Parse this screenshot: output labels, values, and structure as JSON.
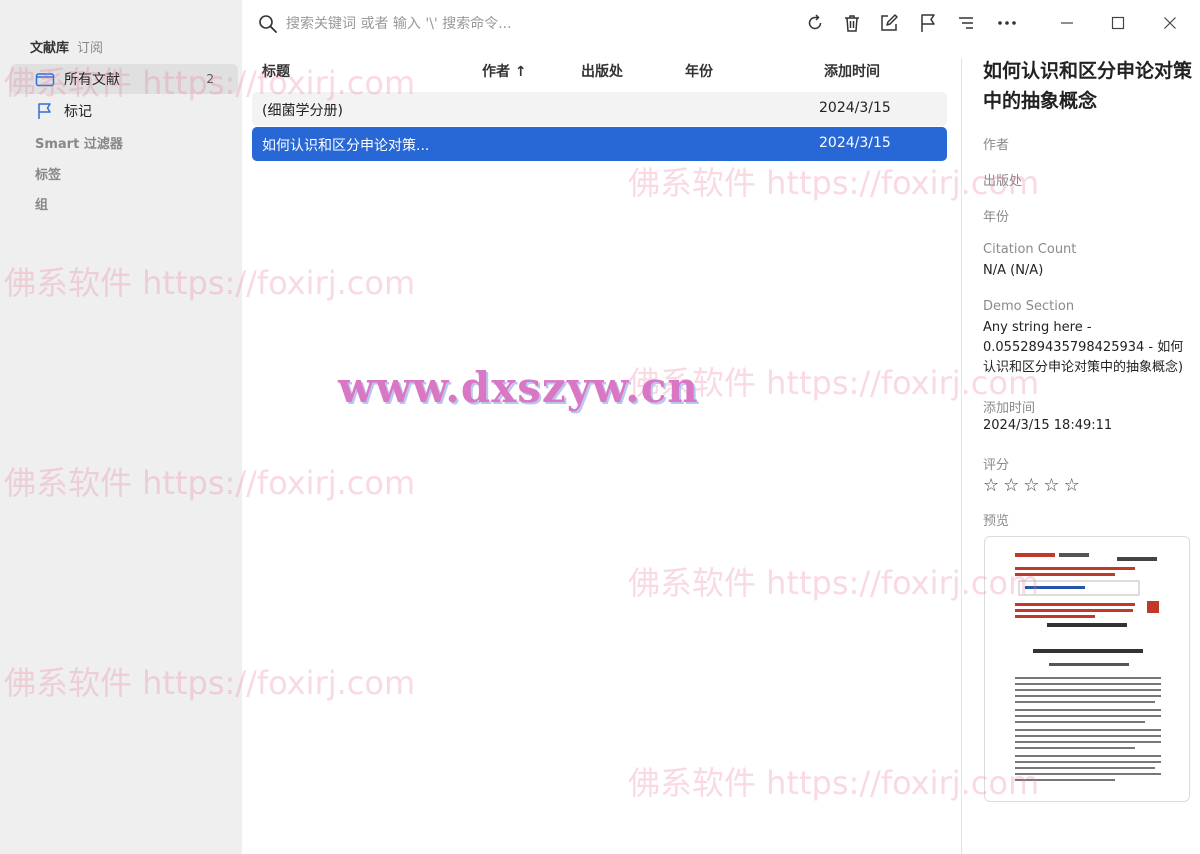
{
  "sidebar": {
    "tabs": [
      "文献库",
      "订阅"
    ],
    "items": [
      {
        "label": "所有文献",
        "count": "2"
      },
      {
        "label": "标记"
      }
    ],
    "sections": [
      "Smart 过滤器",
      "标签",
      "组"
    ]
  },
  "search": {
    "placeholder": "搜索关键词 或者 输入 '\\' 搜索命令..."
  },
  "table": {
    "headers": {
      "title": "标题",
      "author": "作者 ↑",
      "publisher": "出版处",
      "year": "年份",
      "added": "添加时间"
    },
    "rows": [
      {
        "title": "(细菌学分册)",
        "added": "2024/3/15"
      },
      {
        "title": "如何认识和区分申论对策...",
        "added": "2024/3/15"
      }
    ]
  },
  "detail": {
    "title": "如何认识和区分申论对策中的抽象概念",
    "author_label": "作者",
    "publisher_label": "出版处",
    "year_label": "年份",
    "citation_label": "Citation Count",
    "citation_value": "N/A (N/A)",
    "demo_label": "Demo Section",
    "demo_value": "Any string here - 0.055289435798425934 - 如何认识和区分申论对策中的抽象概念)",
    "added_label": "添加时间",
    "added_value": "2024/3/15 18:49:11",
    "rating_label": "评分",
    "rating": 0,
    "preview_label": "预览"
  },
  "watermarks": {
    "foxirj": "佛系软件 https://foxirj.com",
    "dxszyw": "www.dxszyw.cn"
  },
  "colors": {
    "selected_row": "#2867d6",
    "sidebar_bg": "#efefef"
  }
}
